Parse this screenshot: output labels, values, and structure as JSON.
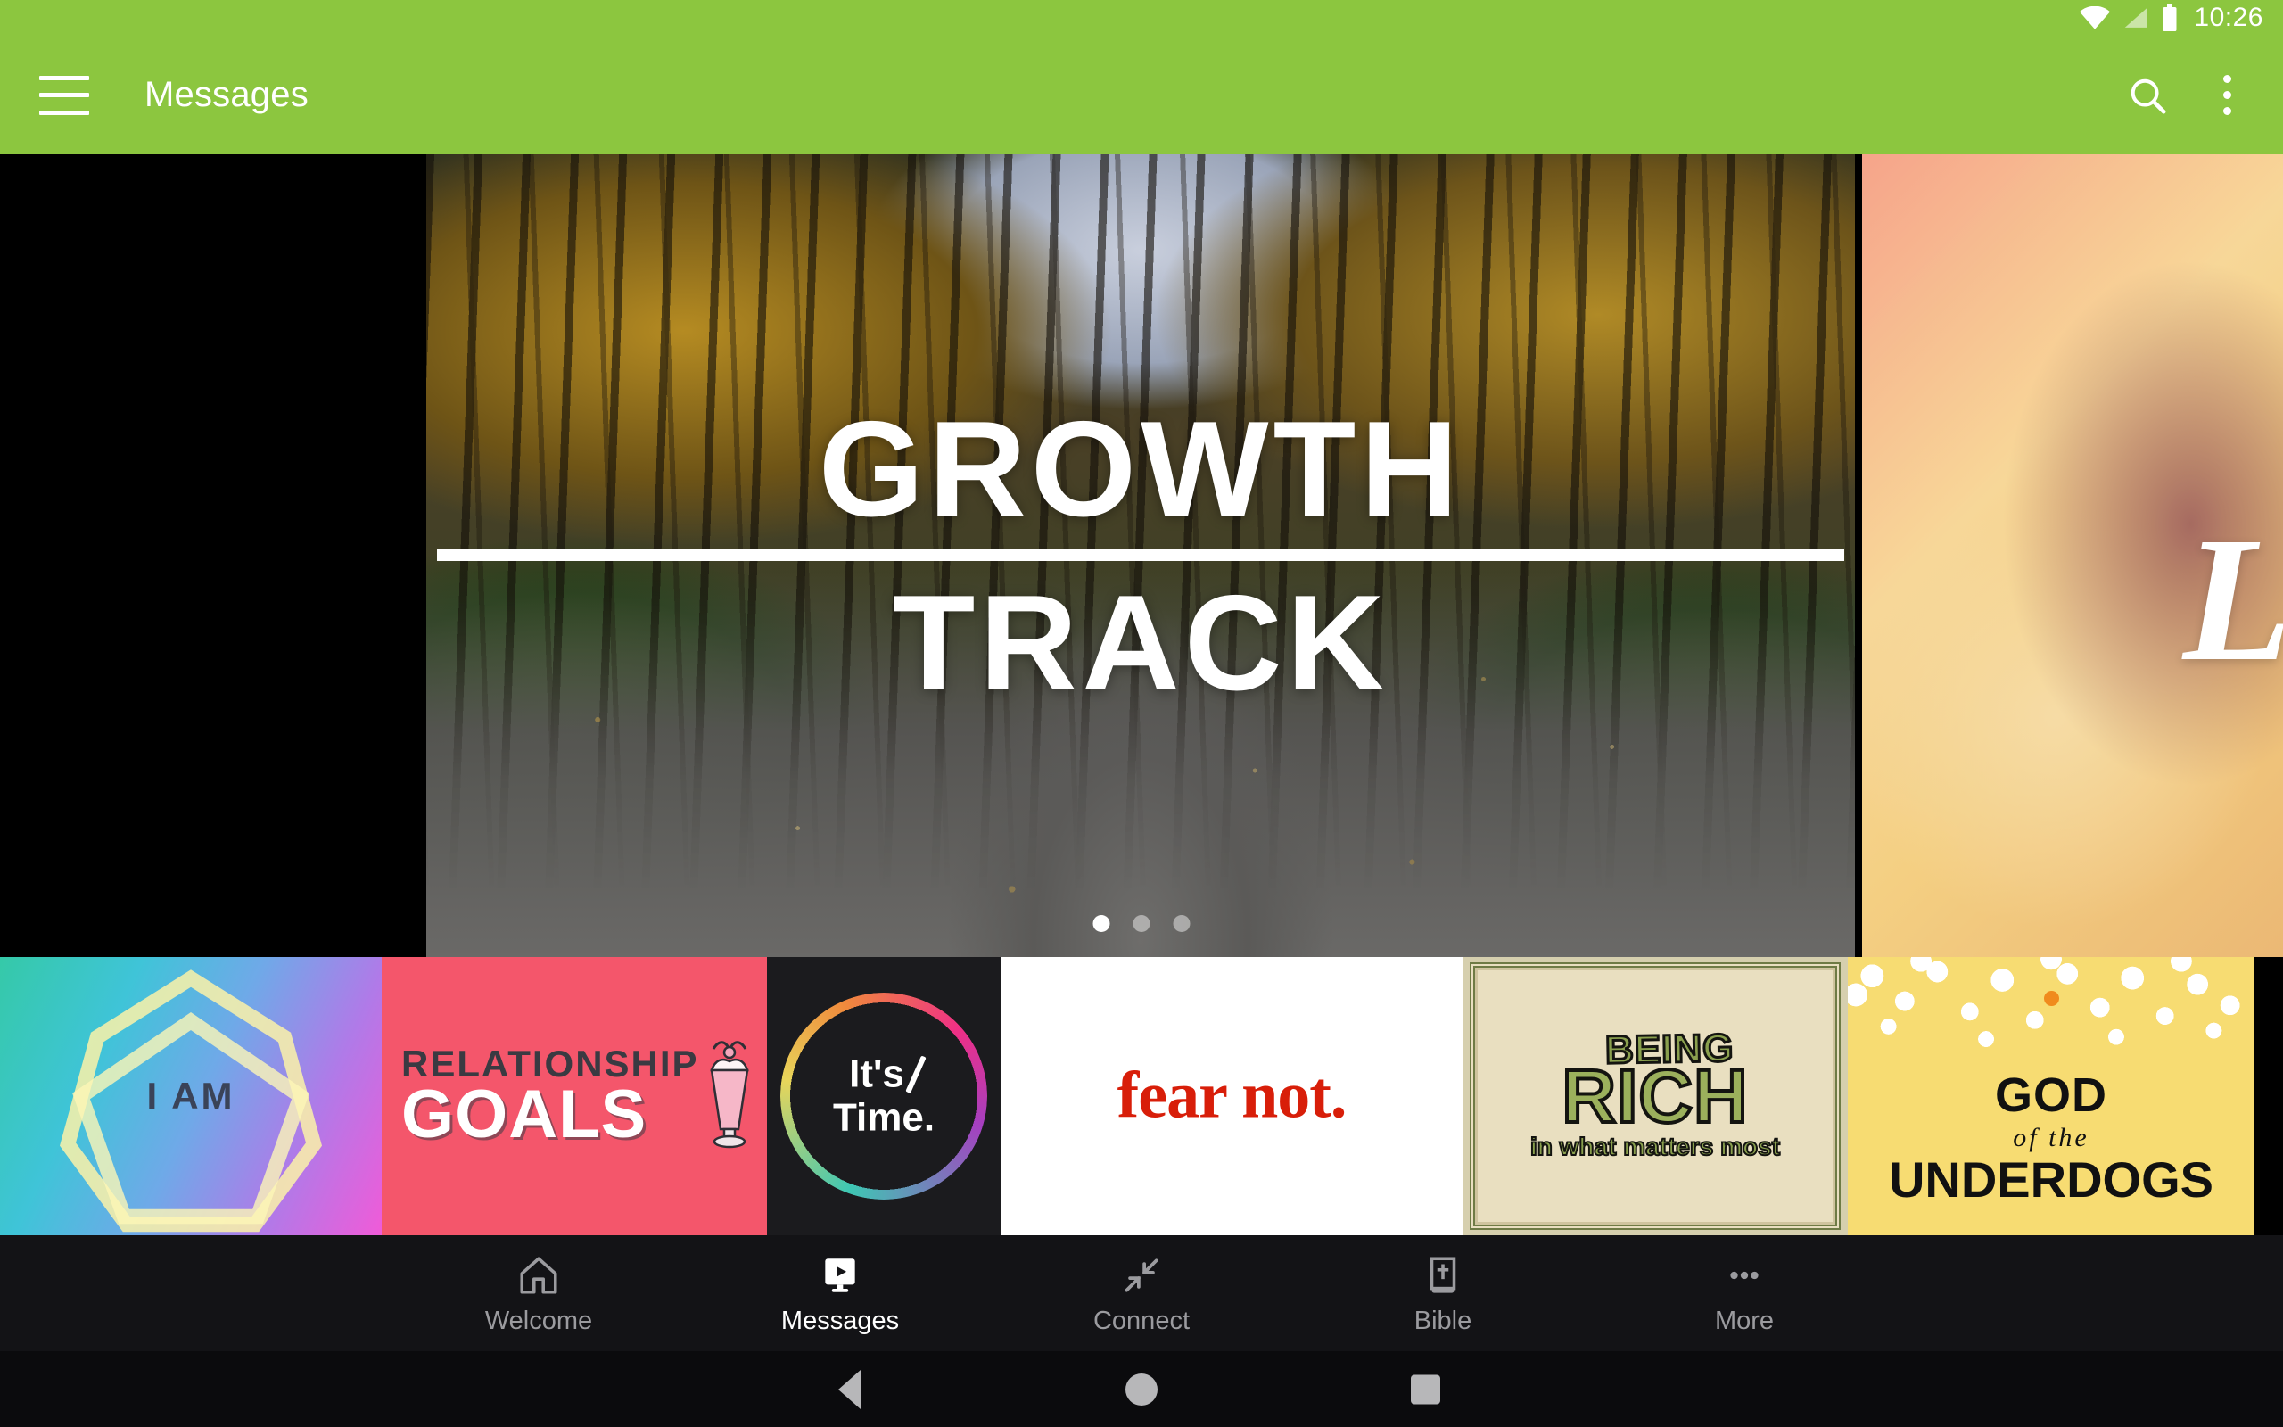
{
  "status_bar": {
    "time": "10:26",
    "icons": [
      "wifi-icon",
      "cellular-signal-icon",
      "battery-icon"
    ]
  },
  "app_bar": {
    "menu_icon": "hamburger-menu-icon",
    "title": "Messages",
    "search_icon": "search-icon",
    "overflow_icon": "overflow-menu-icon"
  },
  "hero_carousel": {
    "current_index": 1,
    "total_pages": 3,
    "slides": [
      {
        "title_line1": "GROWTH",
        "title_line2": "TRACK",
        "background": "autumn-forest-path-photo"
      },
      {
        "script_text": "L",
        "background": "warm-portrait-photo"
      }
    ]
  },
  "thumbnails": [
    {
      "name": "i-am",
      "label": "I AM",
      "bg_start": "#35c9a8",
      "bg_end": "#f05bd8"
    },
    {
      "name": "relationship-goals",
      "line1": "RELATIONSHIP",
      "line2": "GOALS",
      "bg": "#F4566B"
    },
    {
      "name": "its-time",
      "line1": "It's",
      "line2": "Time.",
      "bg": "#1b1b1e"
    },
    {
      "name": "fear-not",
      "label": "fear not.",
      "text_color": "#D81E09",
      "bg": "#ffffff"
    },
    {
      "name": "being-rich",
      "line1": "BEING",
      "line2": "RICH",
      "line3": "in what matters most",
      "bg": "#e9dfc0"
    },
    {
      "name": "god-of-the-underdogs",
      "line1": "GOD",
      "line2": "of the",
      "line3": "UNDERDOGS",
      "bg": "#F7DC72",
      "accent": "#F08B1D"
    }
  ],
  "bottom_nav": {
    "active": "Messages",
    "items": [
      {
        "label": "Welcome",
        "icon": "home-icon",
        "active": false
      },
      {
        "label": "Messages",
        "icon": "video-play-icon",
        "active": true
      },
      {
        "label": "Connect",
        "icon": "connect-arrows-icon",
        "active": false
      },
      {
        "label": "Bible",
        "icon": "bible-book-icon",
        "active": false
      },
      {
        "label": "More",
        "icon": "more-dots-icon",
        "active": false
      }
    ]
  },
  "system_nav": {
    "back": "back-button",
    "home": "home-button",
    "recents": "recents-button"
  },
  "colors": {
    "brand_green": "#8CC63F",
    "nav_background": "#131316",
    "system_background": "#0b0b0d"
  }
}
